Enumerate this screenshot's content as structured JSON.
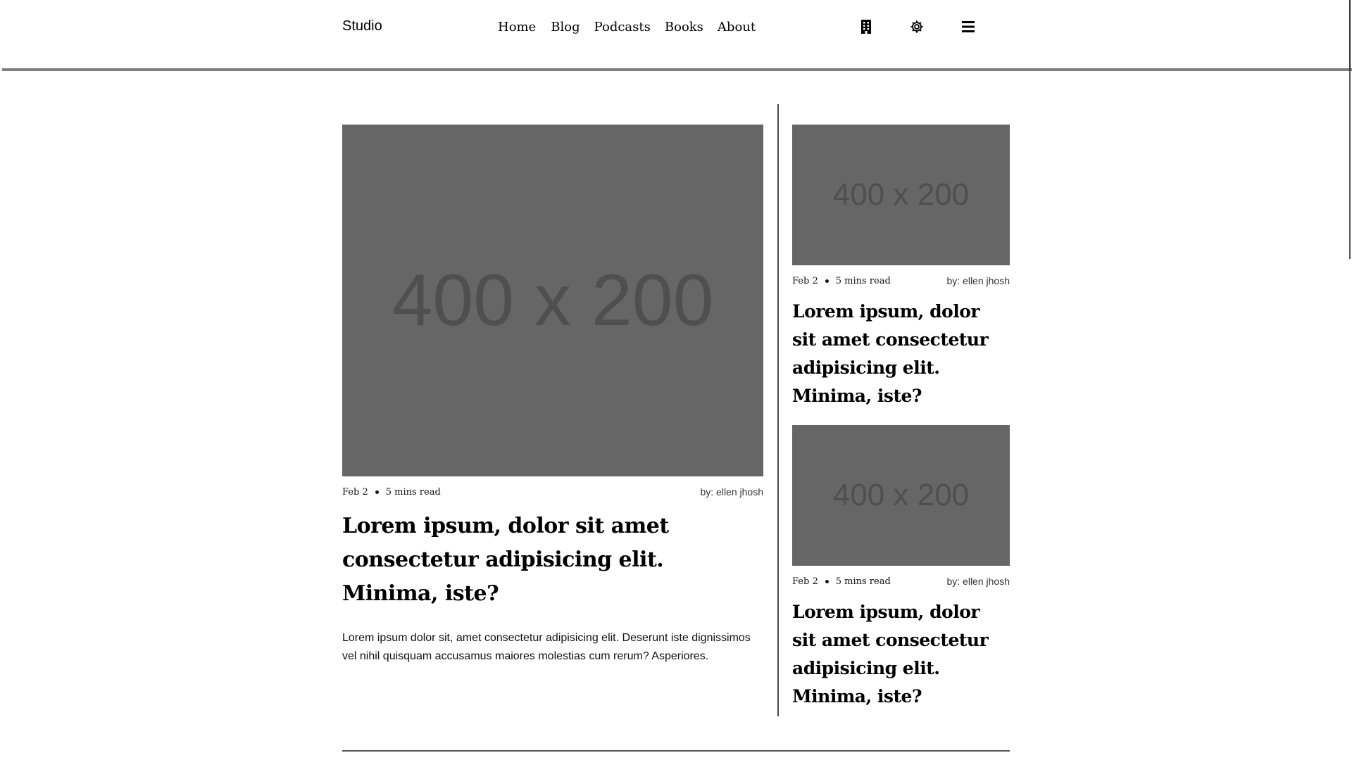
{
  "header": {
    "brand": "Studio",
    "nav": [
      "Home",
      "Blog",
      "Podcasts",
      "Books",
      "About"
    ],
    "icons": [
      "building-icon",
      "gear-icon",
      "hamburger-menu-icon"
    ]
  },
  "featured": {
    "image_text": "400 x 200",
    "date": "Feb 2",
    "read_time": "5 mins read",
    "author": "by: ellen jhosh",
    "title": "Lorem ipsum, dolor sit amet consectetur adipisicing elit. Minima, iste?",
    "excerpt": "Lorem ipsum dolor sit, amet consectetur adipisicing elit. Deserunt iste dignissimos vel nihil quisquam accusamus maiores molestias cum rerum? Asperiores."
  },
  "side": [
    {
      "image_text": "400 x 200",
      "date": "Feb 2",
      "read_time": "5 mins read",
      "author": "by: ellen jhosh",
      "title": "Lorem ipsum, dolor sit amet consectetur adipisicing elit. Minima, iste?"
    },
    {
      "image_text": "400 x 200",
      "date": "Feb 2",
      "read_time": "5 mins read",
      "author": "by: ellen jhosh",
      "title": "Lorem ipsum, dolor sit amet consectetur adipisicing elit. Minima, iste?"
    }
  ],
  "colors": {
    "placeholder_bg": "#666666",
    "placeholder_text": "#4f4f4f",
    "rule": "#808080"
  }
}
